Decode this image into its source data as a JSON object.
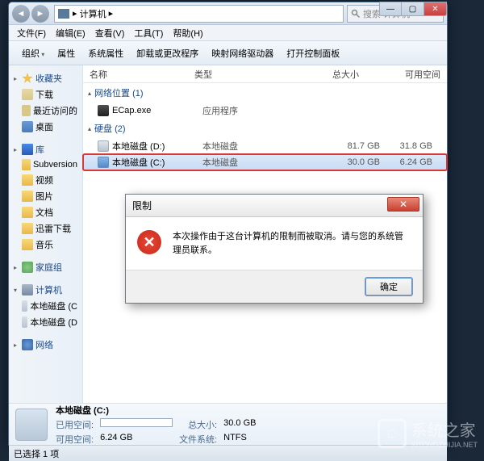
{
  "titlebar": {
    "breadcrumb_icon": "pc",
    "breadcrumb": "计算机",
    "breadcrumb_sep": "▸",
    "search_placeholder": "搜索 计算机"
  },
  "win_controls": {
    "min": "—",
    "max": "▢",
    "close": "✕"
  },
  "menubar": [
    "文件(F)",
    "编辑(E)",
    "查看(V)",
    "工具(T)",
    "帮助(H)"
  ],
  "toolbar": [
    "组织",
    "属性",
    "系统属性",
    "卸载或更改程序",
    "映射网络驱动器",
    "打开控制面板"
  ],
  "columns": {
    "name": "名称",
    "type": "类型",
    "size": "总大小",
    "free": "可用空间"
  },
  "categories": {
    "network": {
      "label": "网络位置 (1)",
      "items": [
        {
          "icon": "exe",
          "name": "ECap.exe",
          "type": "应用程序",
          "size": "",
          "free": ""
        }
      ]
    },
    "disks": {
      "label": "硬盘 (2)",
      "items": [
        {
          "icon": "disk",
          "name": "本地磁盘 (D:)",
          "type": "本地磁盘",
          "size": "81.7 GB",
          "free": "31.8 GB",
          "selected": false,
          "highlighted": false
        },
        {
          "icon": "drive-c",
          "name": "本地磁盘 (C:)",
          "type": "本地磁盘",
          "size": "30.0 GB",
          "free": "6.24 GB",
          "selected": true,
          "highlighted": true
        }
      ]
    }
  },
  "sidebar": {
    "favorites": {
      "label": "收藏夹",
      "items": [
        "下载",
        "最近访问的",
        "桌面"
      ]
    },
    "libraries": {
      "label": "库",
      "items": [
        "Subversion",
        "视频",
        "图片",
        "文档",
        "迅雷下载",
        "音乐"
      ]
    },
    "homegroup": {
      "label": "家庭组"
    },
    "computer": {
      "label": "计算机",
      "items": [
        "本地磁盘 (C",
        "本地磁盘 (D"
      ]
    },
    "network": {
      "label": "网络"
    }
  },
  "details": {
    "title": "本地磁盘 (C:)",
    "used_label": "已用空间:",
    "free_label": "可用空间:",
    "free_value": "6.24 GB",
    "total_label": "总大小:",
    "total_value": "30.0 GB",
    "fs_label": "文件系统:",
    "fs_value": "NTFS"
  },
  "statusbar": "已选择 1 项",
  "dialog": {
    "title": "限制",
    "message": "本次操作由于这台计算机的限制而被取消。请与您的系统管理员联系。",
    "ok": "确定"
  },
  "watermark": {
    "text": "系统之家",
    "url": "XITONGZHIJIA.NET"
  }
}
